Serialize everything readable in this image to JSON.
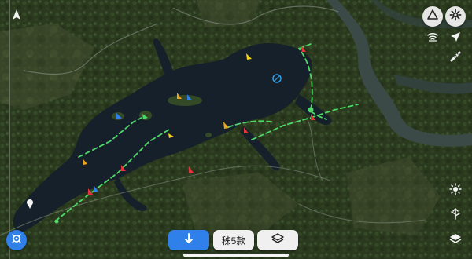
{
  "map": {
    "type": "satellite",
    "accent_color": "#2f80e8",
    "route_color": "#4dd966",
    "marker_colors": [
      "#e8343a",
      "#2f80e8",
      "#f0a41c",
      "#f4d21e"
    ]
  },
  "controls": {
    "bottom_center_label": "秭5款",
    "icons": {
      "compass": "compass-arrow-icon",
      "triangle": "triangle-warning-icon",
      "settings": "gear-icon",
      "wifi": "wifi-signal-icon",
      "location": "location-arrow-icon",
      "measure": "ruler-icon",
      "brightness": "sun-brightness-icon",
      "route": "route-split-icon",
      "layers": "layers-icon",
      "download": "down-arrow-icon",
      "gps": "gps-satellite-icon"
    }
  }
}
